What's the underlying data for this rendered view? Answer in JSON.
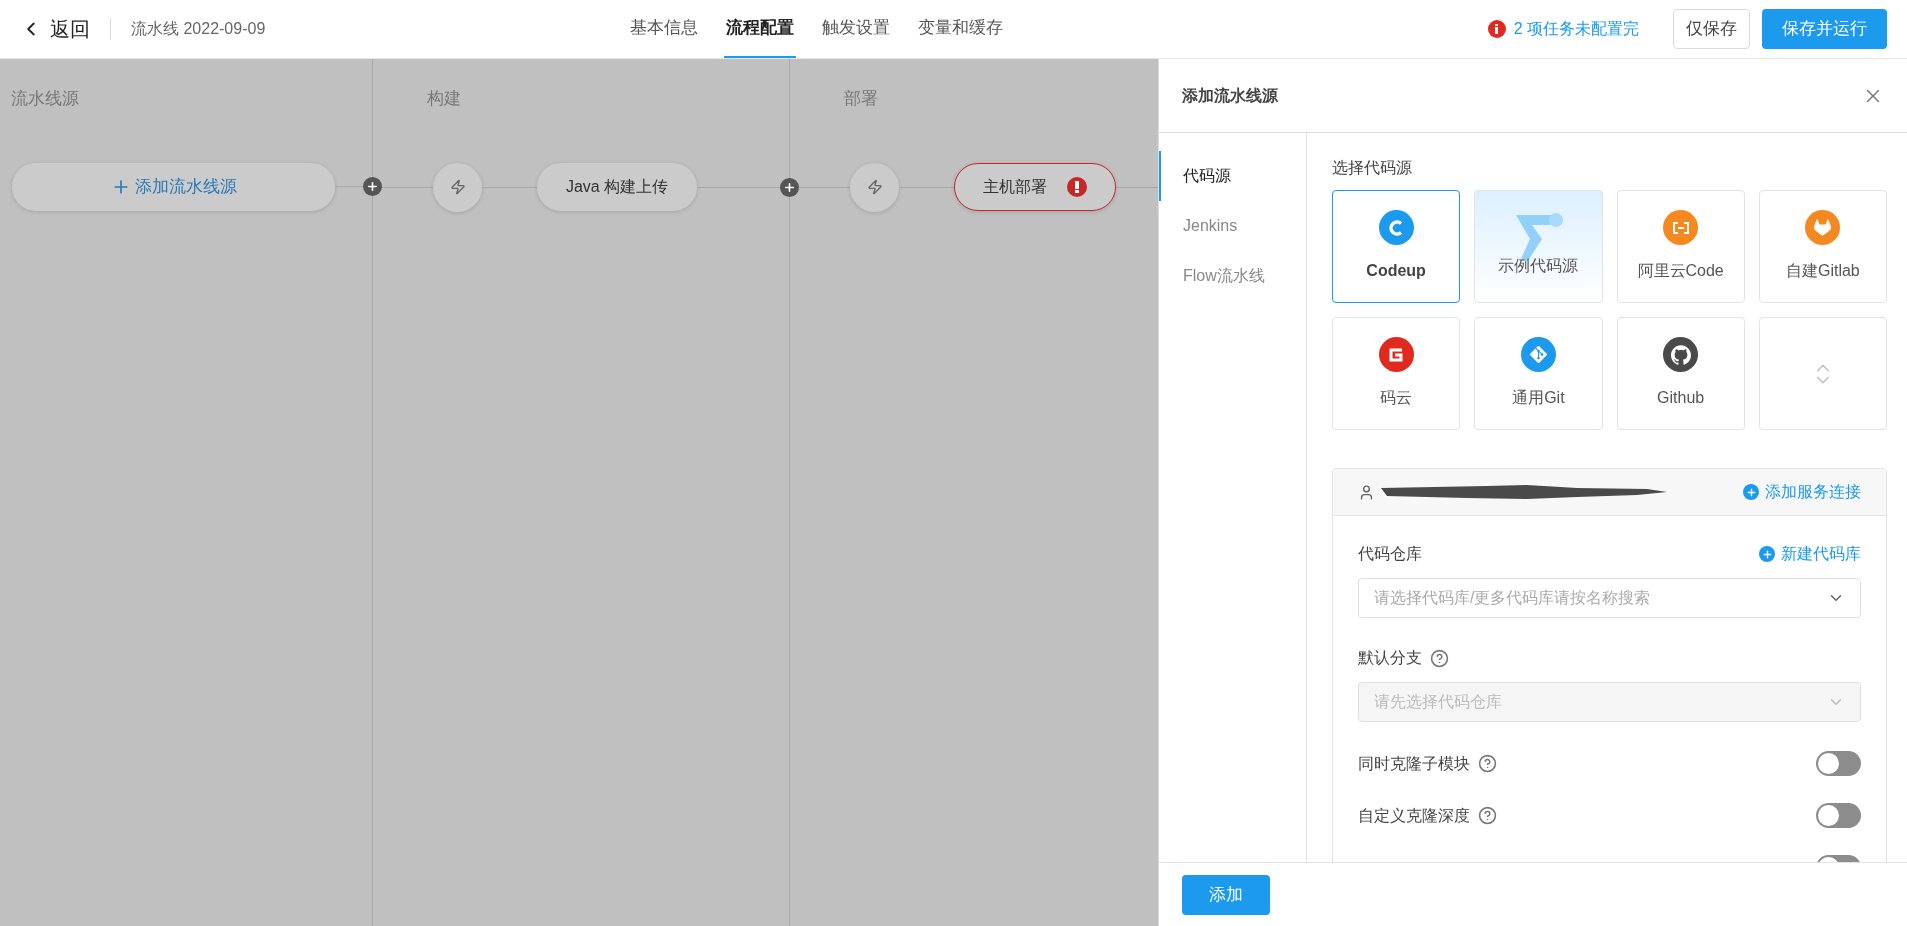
{
  "header": {
    "back_label": "返回",
    "pipeline_title": "流水线 2022-09-09",
    "tabs": [
      {
        "label": "基本信息",
        "selected": false
      },
      {
        "label": "流程配置",
        "selected": true
      },
      {
        "label": "触发设置",
        "selected": false
      },
      {
        "label": "变量和缓存",
        "selected": false
      }
    ],
    "warning": "2 项任务未配置完",
    "buttons": [
      {
        "label": "仅保存",
        "kind": "secondary"
      },
      {
        "label": "保存并运行",
        "kind": "primary"
      }
    ]
  },
  "canvas": {
    "stages": [
      {
        "title": "流水线源",
        "nodes": [
          {
            "kind": "add",
            "label": "添加流水线源"
          }
        ]
      },
      {
        "title": "构建",
        "nodes": [
          {
            "kind": "trigger"
          },
          {
            "kind": "job",
            "label": "Java 构建上传",
            "error": false
          }
        ]
      },
      {
        "title": "部署",
        "nodes": [
          {
            "kind": "trigger"
          },
          {
            "kind": "job",
            "label": "主机部署",
            "error": true
          }
        ]
      }
    ]
  },
  "panel": {
    "title": "添加流水线源",
    "nav": [
      {
        "label": "代码源",
        "selected": true
      },
      {
        "label": "Jenkins",
        "selected": false
      },
      {
        "label": "Flow流水线",
        "selected": false
      }
    ],
    "section_label": "选择代码源",
    "sources": [
      {
        "kind": "codeup",
        "label": "Codeup",
        "selected": true
      },
      {
        "kind": "sample",
        "label": "示例代码源",
        "selected": false
      },
      {
        "kind": "aliyun",
        "label": "阿里云Code",
        "selected": false
      },
      {
        "kind": "gitlab",
        "label": "自建Gitlab",
        "selected": false
      },
      {
        "kind": "gitee",
        "label": "码云",
        "selected": false
      },
      {
        "kind": "git",
        "label": "通用Git",
        "selected": false
      },
      {
        "kind": "github",
        "label": "Github",
        "selected": false
      },
      {
        "kind": "more",
        "selected": false
      }
    ],
    "connection": {
      "add_link": "添加服务连接",
      "fields": [
        {
          "label": "代码仓库",
          "help": false,
          "link": "新建代码库",
          "placeholder": "请选择代码库/更多代码库请按名称搜索",
          "disabled": false
        },
        {
          "label": "默认分支",
          "help": true,
          "placeholder": "请先选择代码仓库",
          "disabled": true
        }
      ],
      "toggles": [
        {
          "label": "同时克隆子模块",
          "on": false
        },
        {
          "label": "自定义克隆深度",
          "on": false
        },
        {
          "on": false
        }
      ]
    },
    "submit": "添加"
  }
}
